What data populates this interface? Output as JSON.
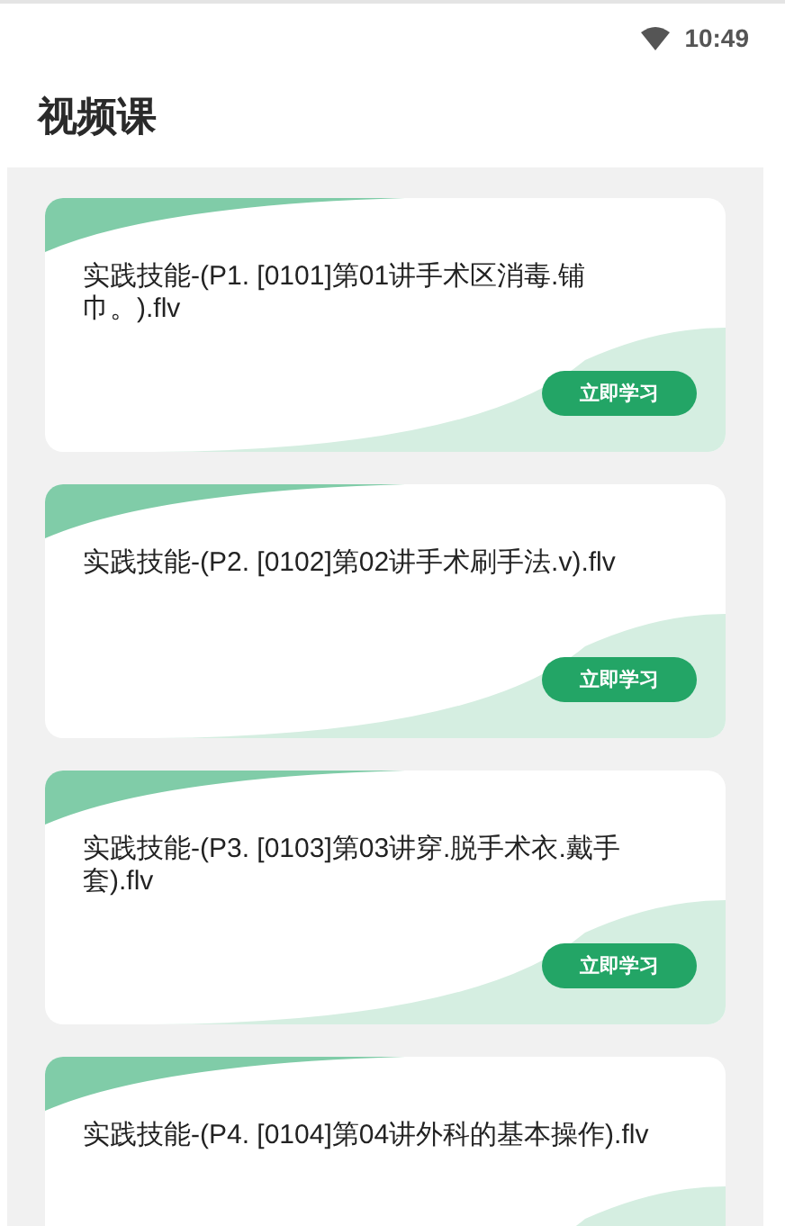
{
  "status_bar": {
    "time": "10:49"
  },
  "header": {
    "title": "视频课"
  },
  "courses": [
    {
      "title": "实践技能-(P1. [0101]第01讲手术区消毒.铺巾。).flv",
      "button": "立即学习"
    },
    {
      "title": "实践技能-(P2. [0102]第02讲手术刷手法.v).flv",
      "button": "立即学习"
    },
    {
      "title": "实践技能-(P3. [0103]第03讲穿.脱手术衣.戴手套).flv",
      "button": "立即学习"
    },
    {
      "title": "实践技能-(P4. [0104]第04讲外科的基本操作).flv"
    }
  ]
}
